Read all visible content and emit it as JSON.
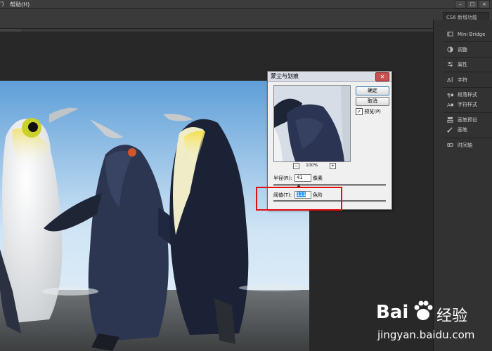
{
  "menubar": {
    "items": [
      {
        "label": "’)"
      },
      {
        "label": "帮助(H)"
      }
    ],
    "window_controls": [
      "–",
      "□",
      "×"
    ]
  },
  "optionsbar": {
    "workspace": "CS6 新增功能"
  },
  "panels": {
    "items": [
      {
        "label": "Mini Bridge",
        "icon": "mini-bridge-icon"
      },
      {
        "label": "调整",
        "icon": "adjustments-icon"
      },
      {
        "label": "属性",
        "icon": "properties-icon"
      },
      {
        "label": "字符",
        "icon": "character-icon"
      },
      {
        "label": "段落样式",
        "icon": "paragraph-styles-icon"
      },
      {
        "label": "字符样式",
        "icon": "character-styles-icon"
      },
      {
        "label": "画笔预设",
        "icon": "brush-presets-icon"
      },
      {
        "label": "画笔",
        "icon": "brush-icon"
      },
      {
        "label": "时间轴",
        "icon": "timeline-icon"
      }
    ]
  },
  "dialog": {
    "title": "蒙尘与划痕",
    "close": "✕",
    "ok_label": "确定",
    "cancel_label": "取消",
    "preview_label": "预览(P)",
    "preview_checked": true,
    "zoom_minus": "−",
    "zoom_plus": "+",
    "zoom_value": "100%",
    "radius_label": "半径(R):",
    "radius_value": "41",
    "radius_unit": "像素",
    "threshold_label": "阈值(T):",
    "threshold_value": "111",
    "threshold_unit": "色阶"
  },
  "watermark": {
    "brand_left": "Bai",
    "brand_right": "经验",
    "url": "jingyan.baidu.com"
  },
  "colors": {
    "highlight_box": "#e01010",
    "panel_bg": "#323232",
    "dialog_bg": "#f0f0f0"
  }
}
